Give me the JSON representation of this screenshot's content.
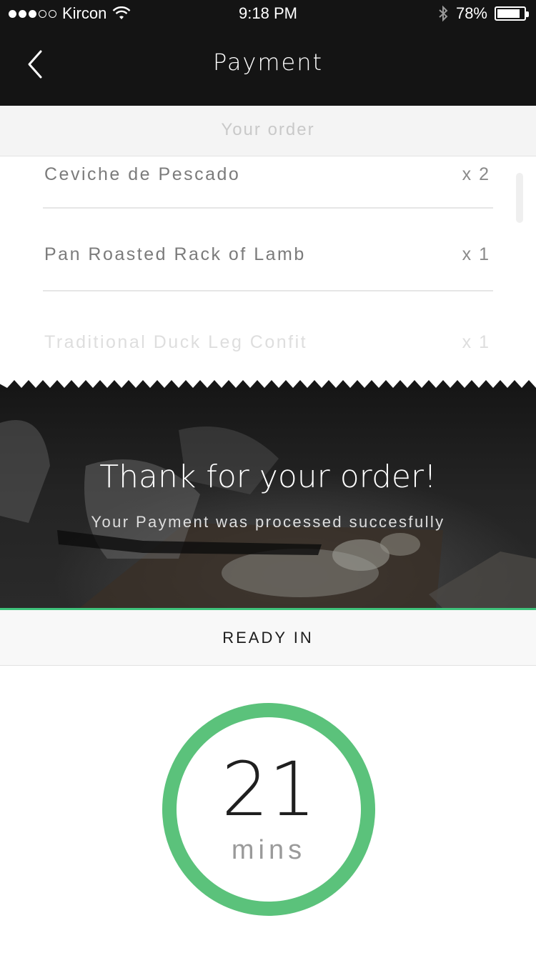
{
  "status_bar": {
    "carrier": "Kircon",
    "time": "9:18 PM",
    "battery_percent": "78%",
    "battery_level": 0.78,
    "signal_bars_filled": 3,
    "signal_bars_total": 5
  },
  "nav": {
    "title": "Payment",
    "back_icon": "chevron-left-icon"
  },
  "order": {
    "header": "Your order",
    "items": [
      {
        "name": "Ceviche de Pescado",
        "qty": "x 2"
      },
      {
        "name": "Pan Roasted Rack of Lamb",
        "qty": "x 1"
      },
      {
        "name": "Traditional Duck Leg Confit",
        "qty": "x 1"
      }
    ]
  },
  "confirmation": {
    "title": "Thank for your order!",
    "subtitle": "Your Payment was processed succesfully"
  },
  "ready": {
    "label": "READY IN",
    "value": "21",
    "unit": "mins"
  },
  "colors": {
    "accent": "#5bc27b",
    "header_bg": "#141414"
  }
}
